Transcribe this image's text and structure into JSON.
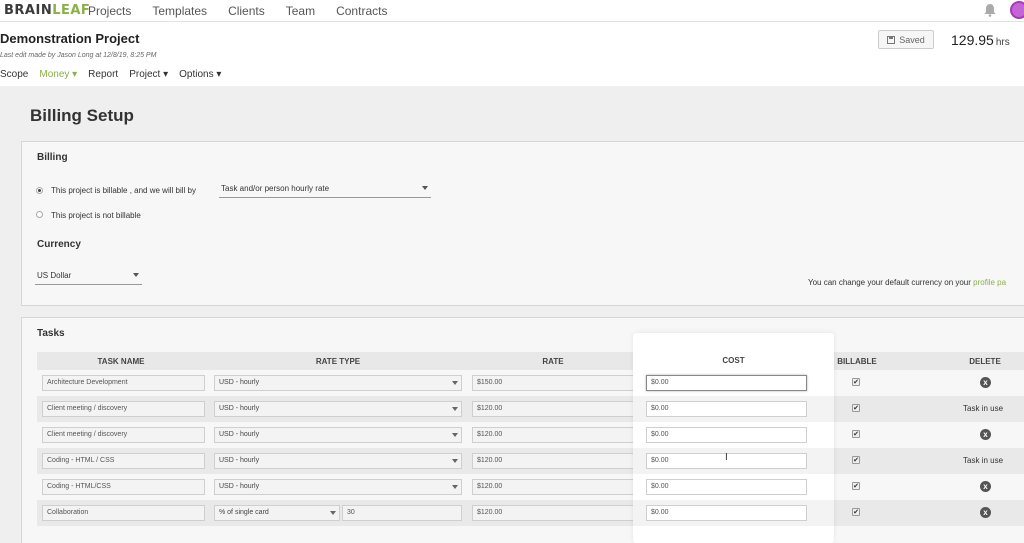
{
  "nav": {
    "logo_a": "BRAIN",
    "logo_b": "LEAF",
    "links": [
      "Projects",
      "Templates",
      "Clients",
      "Team",
      "Contracts"
    ]
  },
  "project": {
    "title": "Demonstration Project",
    "last_edit": "Last edit made by Jason Long at 12/8/19, 8:25 PM",
    "saved_label": "Saved",
    "hours_value": "129.95",
    "hours_unit": "hrs",
    "subnav": [
      "Scope",
      "Money ▾",
      "Report",
      "Project ▾",
      "Options ▾"
    ]
  },
  "billing": {
    "page_title": "Billing Setup",
    "heading": "Billing",
    "billable_text": "This project is billable , and we will bill by",
    "bill_by_value": "Task and/or person hourly rate",
    "not_billable_text": "This project is not billable",
    "currency_heading": "Currency",
    "currency_value": "US Dollar",
    "profile_note": "You can change your default currency on your",
    "profile_link": "profile pa"
  },
  "tasks": {
    "heading": "Tasks",
    "columns": {
      "task_name": "TASK NAME",
      "rate_type": "RATE TYPE",
      "rate": "RATE",
      "cost": "COST",
      "billable": "BILLABLE",
      "delete": "DELETE"
    },
    "rows": [
      {
        "name": "Architecture Development",
        "rate_type": "USD - hourly",
        "pct": "",
        "rate": "$150.00",
        "cost": "$0.00",
        "billable": "✔",
        "delete": "x",
        "in_use": ""
      },
      {
        "name": "Client meeting / discovery",
        "rate_type": "USD - hourly",
        "pct": "",
        "rate": "$120.00",
        "cost": "$0.00",
        "billable": "✔",
        "delete": "",
        "in_use": "Task in use"
      },
      {
        "name": "Client meeting / discovery",
        "rate_type": "USD - hourly",
        "pct": "",
        "rate": "$120.00",
        "cost": "$0.00",
        "billable": "✔",
        "delete": "x",
        "in_use": ""
      },
      {
        "name": "Coding - HTML / CSS",
        "rate_type": "USD - hourly",
        "pct": "",
        "rate": "$120.00",
        "cost": "$0.00",
        "billable": "✔",
        "delete": "",
        "in_use": "Task in use"
      },
      {
        "name": "Coding - HTML/CSS",
        "rate_type": "USD - hourly",
        "pct": "",
        "rate": "$120.00",
        "cost": "$0.00",
        "billable": "✔",
        "delete": "x",
        "in_use": ""
      },
      {
        "name": "Collaboration",
        "rate_type": "% of single card",
        "pct": "30",
        "rate": "$120.00",
        "cost": "$0.00",
        "billable": "✔",
        "delete": "x",
        "in_use": ""
      }
    ]
  },
  "colors": {
    "accent_green": "#8bb04a",
    "avatar_purple": "#c564d6"
  }
}
